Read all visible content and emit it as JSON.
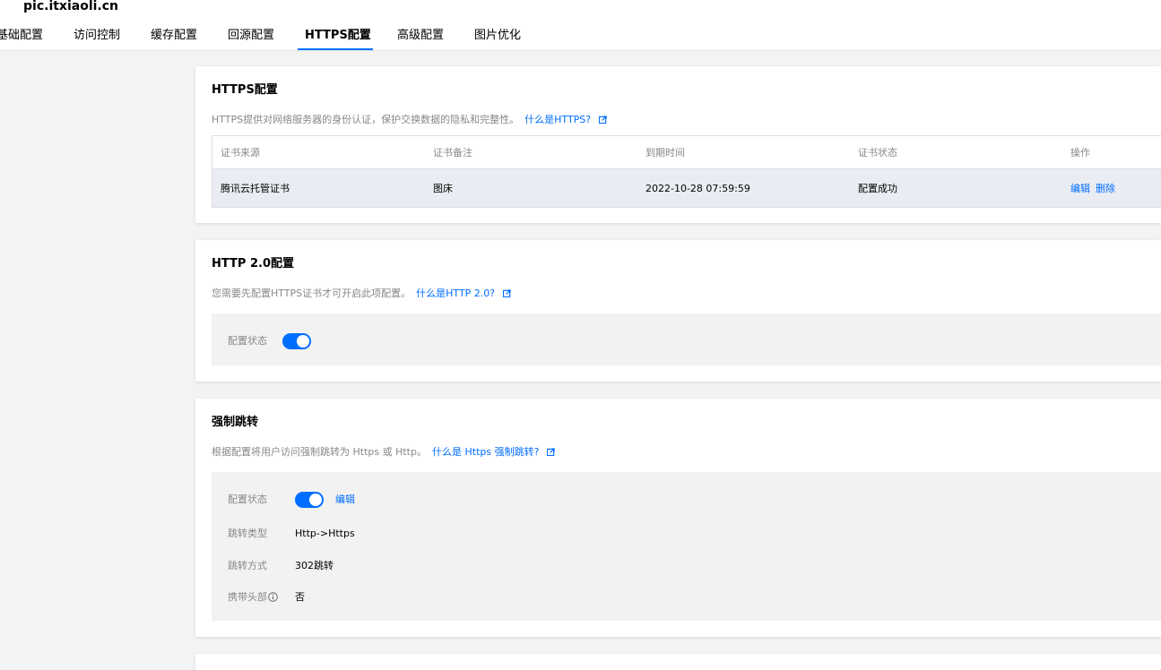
{
  "header": {
    "domain": "pic.itxiaoli.cn",
    "tabs": [
      {
        "label": "基础配置"
      },
      {
        "label": "访问控制"
      },
      {
        "label": "缓存配置"
      },
      {
        "label": "回源配置"
      },
      {
        "label": "HTTPS配置",
        "active": true
      },
      {
        "label": "高级配置"
      },
      {
        "label": "图片优化"
      }
    ]
  },
  "https_card": {
    "title": "HTTPS配置",
    "desc": "HTTPS提供对网络服务器的身份认证，保护交换数据的隐私和完整性。",
    "link": "什么是HTTPS?",
    "table": {
      "headers": [
        "证书来源",
        "证书备注",
        "到期时间",
        "证书状态",
        "操作"
      ],
      "rows": [
        {
          "source": "腾讯云托管证书",
          "note": "图床",
          "expire": "2022-10-28 07:59:59",
          "status": "配置成功",
          "edit": "编辑",
          "delete": "删除"
        }
      ]
    }
  },
  "http2_card": {
    "title": "HTTP 2.0配置",
    "desc": "您需要先配置HTTPS证书才可开启此项配置。",
    "link": "什么是HTTP 2.0?",
    "status_label": "配置状态",
    "enabled": true
  },
  "redirect_card": {
    "title": "强制跳转",
    "desc": "根据配置将用户访问强制跳转为 Https 或 Http。",
    "link": "什么是 Https 强制跳转?",
    "status_label": "配置状态",
    "enabled": true,
    "edit": "编辑",
    "type_label": "跳转类型",
    "type_value": "Http->Https",
    "method_label": "跳转方式",
    "method_value": "302跳转",
    "header_label": "携带头部",
    "header_value": "否"
  },
  "colors": {
    "accent": "#006eff",
    "page_bg": "#f2f3f5",
    "panel_bg": "#f2f2f2",
    "row_bg": "#e9edf3"
  }
}
